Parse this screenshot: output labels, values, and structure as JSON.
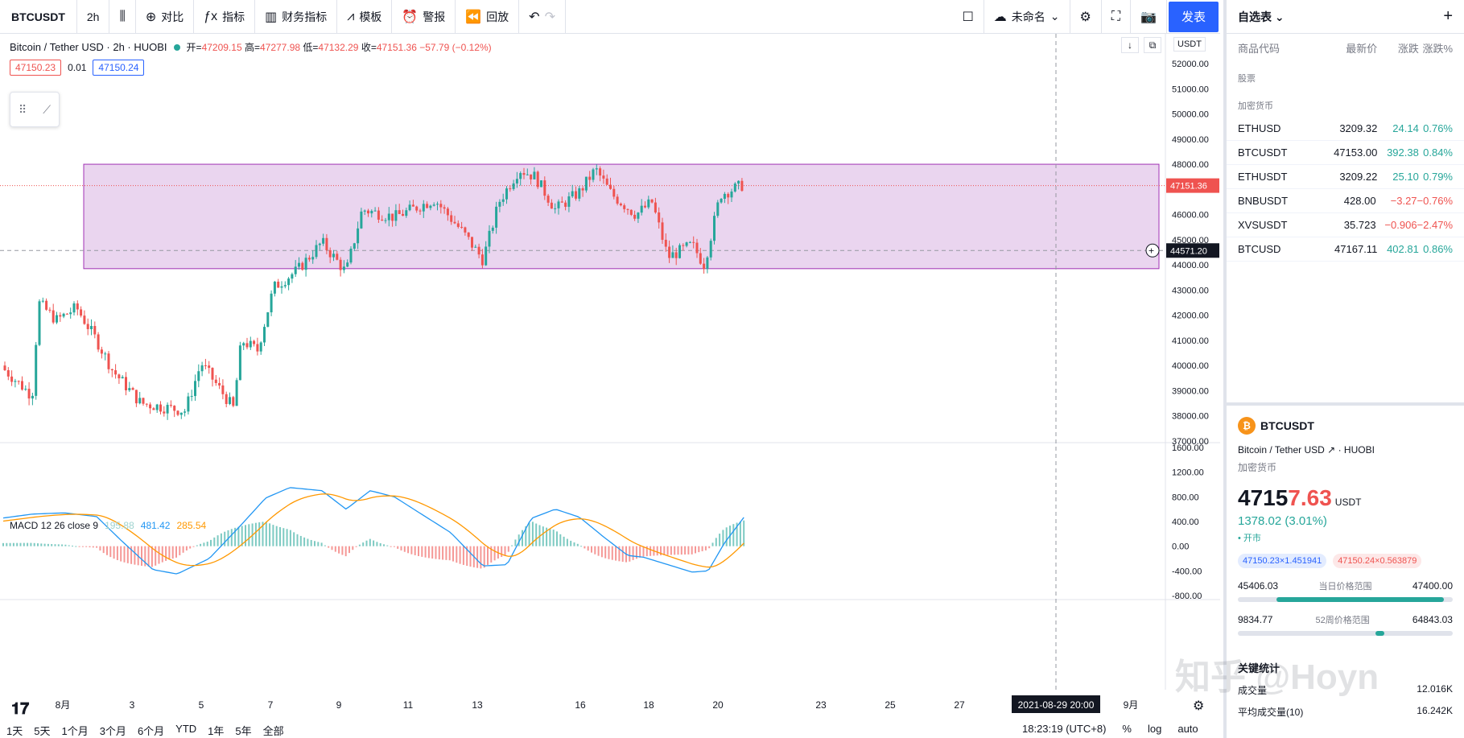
{
  "toolbar": {
    "symbol": "BTCUSDT",
    "interval": "2h",
    "compare_label": "对比",
    "indicators_label": "指标",
    "financials_label": "财务指标",
    "templates_label": "模板",
    "alert_label": "警报",
    "replay_label": "回放",
    "layout_name": "未命名",
    "publish_label": "发表"
  },
  "legend": {
    "title": "Bitcoin / Tether USD · 2h · HUOBI",
    "open_k": "开=",
    "open": "47209.15",
    "high_k": "高=",
    "high": "47277.98",
    "low_k": "低=",
    "low": "47132.29",
    "close_k": "收=",
    "close": "47151.36",
    "change": "−57.79 (−0.12%)",
    "bid": "47150.23",
    "spread": "0.01",
    "ask": "47150.24"
  },
  "macd_legend": {
    "name": "MACD 12 26 close 9",
    "hist": "195.88",
    "macd": "481.42",
    "signal": "285.54"
  },
  "price_axis": {
    "currency": "USDT",
    "ticks": [
      "52000.00",
      "51000.00",
      "50000.00",
      "49000.00",
      "48000.00",
      "47000.00",
      "46000.00",
      "45000.00",
      "44000.00",
      "43000.00",
      "42000.00",
      "41000.00",
      "40000.00",
      "39000.00",
      "38000.00",
      "37000.00"
    ],
    "last_price_label": "47151.36",
    "cursor_price_label": "44571.20"
  },
  "macd_axis": {
    "ticks": [
      "1600.00",
      "1200.00",
      "800.00",
      "400.00",
      "0.00",
      "-400.00",
      "-800.00"
    ]
  },
  "time_axis": {
    "ticks": [
      "8月",
      "3",
      "5",
      "7",
      "9",
      "11",
      "13",
      "16",
      "18",
      "20",
      "23",
      "25",
      "27",
      "9月"
    ],
    "cursor_label": "2021-08-29   20:00"
  },
  "bottom": {
    "ranges": [
      "1天",
      "5天",
      "1个月",
      "3个月",
      "6个月",
      "YTD",
      "1年",
      "5年",
      "全部"
    ],
    "clock": "18:23:19 (UTC+8)",
    "pct": "%",
    "log": "log",
    "auto": "auto"
  },
  "watchlist": {
    "title": "自选表",
    "col_symbol": "商品代码",
    "col_last": "最新价",
    "col_chg": "涨跌",
    "col_chgp": "涨跌%",
    "section_stocks": "股票",
    "section_crypto": "加密货币",
    "rows": [
      {
        "sym": "ETHUSD",
        "last": "3209.32",
        "chg": "24.14",
        "chgp": "0.76%",
        "dir": "up"
      },
      {
        "sym": "BTCUSDT",
        "last": "47153.00",
        "chg": "392.38",
        "chgp": "0.84%",
        "dir": "up"
      },
      {
        "sym": "ETHUSDT",
        "last": "3209.22",
        "chg": "25.10",
        "chgp": "0.79%",
        "dir": "up"
      },
      {
        "sym": "BNBUSDT",
        "last": "428.00",
        "chg": "−3.27",
        "chgp": "−0.76%",
        "dir": "down"
      },
      {
        "sym": "XVSUSDT",
        "last": "35.723",
        "chg": "−0.906",
        "chgp": "−2.47%",
        "dir": "down"
      },
      {
        "sym": "BTCUSD",
        "last": "47167.11",
        "chg": "402.81",
        "chgp": "0.86%",
        "dir": "up"
      }
    ]
  },
  "detail": {
    "symbol": "BTCUSDT",
    "name": "Bitcoin / Tether USD",
    "exchange": "HUOBI",
    "category": "加密货币",
    "price_main": "4715",
    "price_hi": "7.63",
    "currency": "USDT",
    "change": "1378.02 (3.01%)",
    "market": "• 开市",
    "bid_pill": "47150.23×1.451941",
    "ask_pill": "47150.24×0.563879",
    "day_low": "45406.03",
    "day_label": "当日价格范围",
    "day_high": "47400.00",
    "w52_low": "9834.77",
    "w52_label": "52周价格范围",
    "w52_high": "64843.03",
    "stats_title": "关键统计",
    "volume_label": "成交量",
    "volume": "12.016K",
    "avg_volume_label": "平均成交量(10)",
    "avg_volume": "16.242K"
  },
  "watermark": "知乎 @Hoyn",
  "colors": {
    "up": "#26a69a",
    "down": "#ef5350",
    "accent": "#2962ff",
    "rect_fill": "#e9d3ef",
    "rect_stroke": "#9c27b0"
  }
}
